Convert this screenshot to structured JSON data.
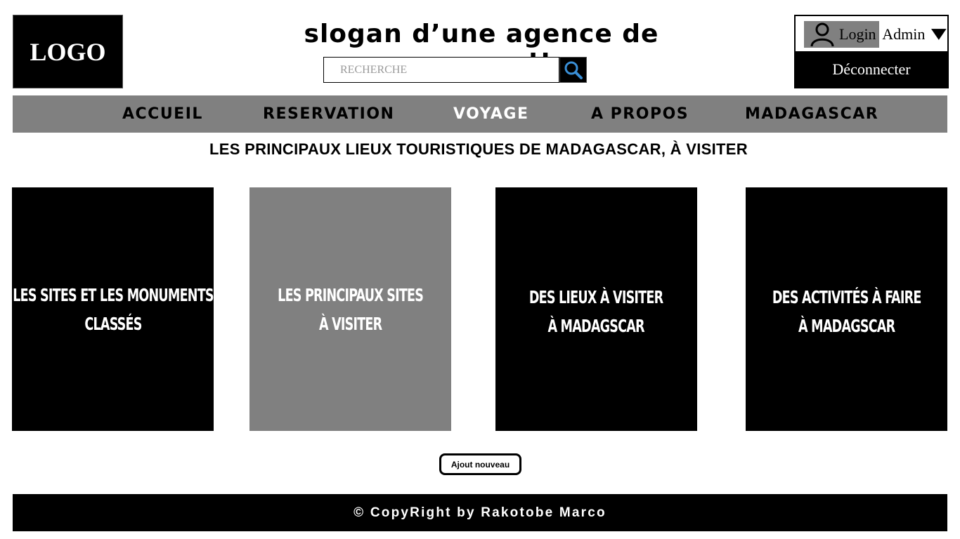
{
  "header": {
    "logo_text": "LOGO",
    "slogan": "slogan d’une agence de voyage !!",
    "search": {
      "placeholder": "RECHERCHE",
      "value": ""
    },
    "user": {
      "login_label": "Login",
      "role_label": "Admin",
      "logout_label": "Déconnecter"
    }
  },
  "nav": {
    "items": [
      {
        "label": "ACCUEIL",
        "active": false
      },
      {
        "label": "RESERVATION",
        "active": false
      },
      {
        "label": "VOYAGE",
        "active": true
      },
      {
        "label": "A PROPOS",
        "active": false
      },
      {
        "label": "MADAGASCAR",
        "active": false
      }
    ]
  },
  "main": {
    "title": "LES PRINCIPAUX LIEUX TOURISTIQUES DE MADAGASCAR, À VISITER",
    "cards": [
      {
        "line1": "LES SITES ET LES MONUMENTS",
        "line2": "CLASSÉS",
        "bg": "#000000"
      },
      {
        "line1": "LES PRINCIPAUX SITES",
        "line2": "À VISITER",
        "bg": "#808080"
      },
      {
        "line1": "DES LIEUX À VISITER",
        "line2": "À MADAGSCAR",
        "bg": "#000000"
      },
      {
        "line1": "DES ACTIVITÉS À FAIRE",
        "line2": "À MADAGSCAR",
        "bg": "#000000"
      }
    ],
    "add_button_label": "Ajout nouveau"
  },
  "footer": {
    "copyright": "© CopyRight by Rakotobe Marco"
  },
  "colors": {
    "black": "#000000",
    "gray": "#808080",
    "white": "#ffffff",
    "search_icon_blue": "#3a8fd6"
  },
  "icons": {
    "search": "magnifier-icon",
    "user": "user-icon",
    "dropdown": "triangle-down-icon"
  }
}
